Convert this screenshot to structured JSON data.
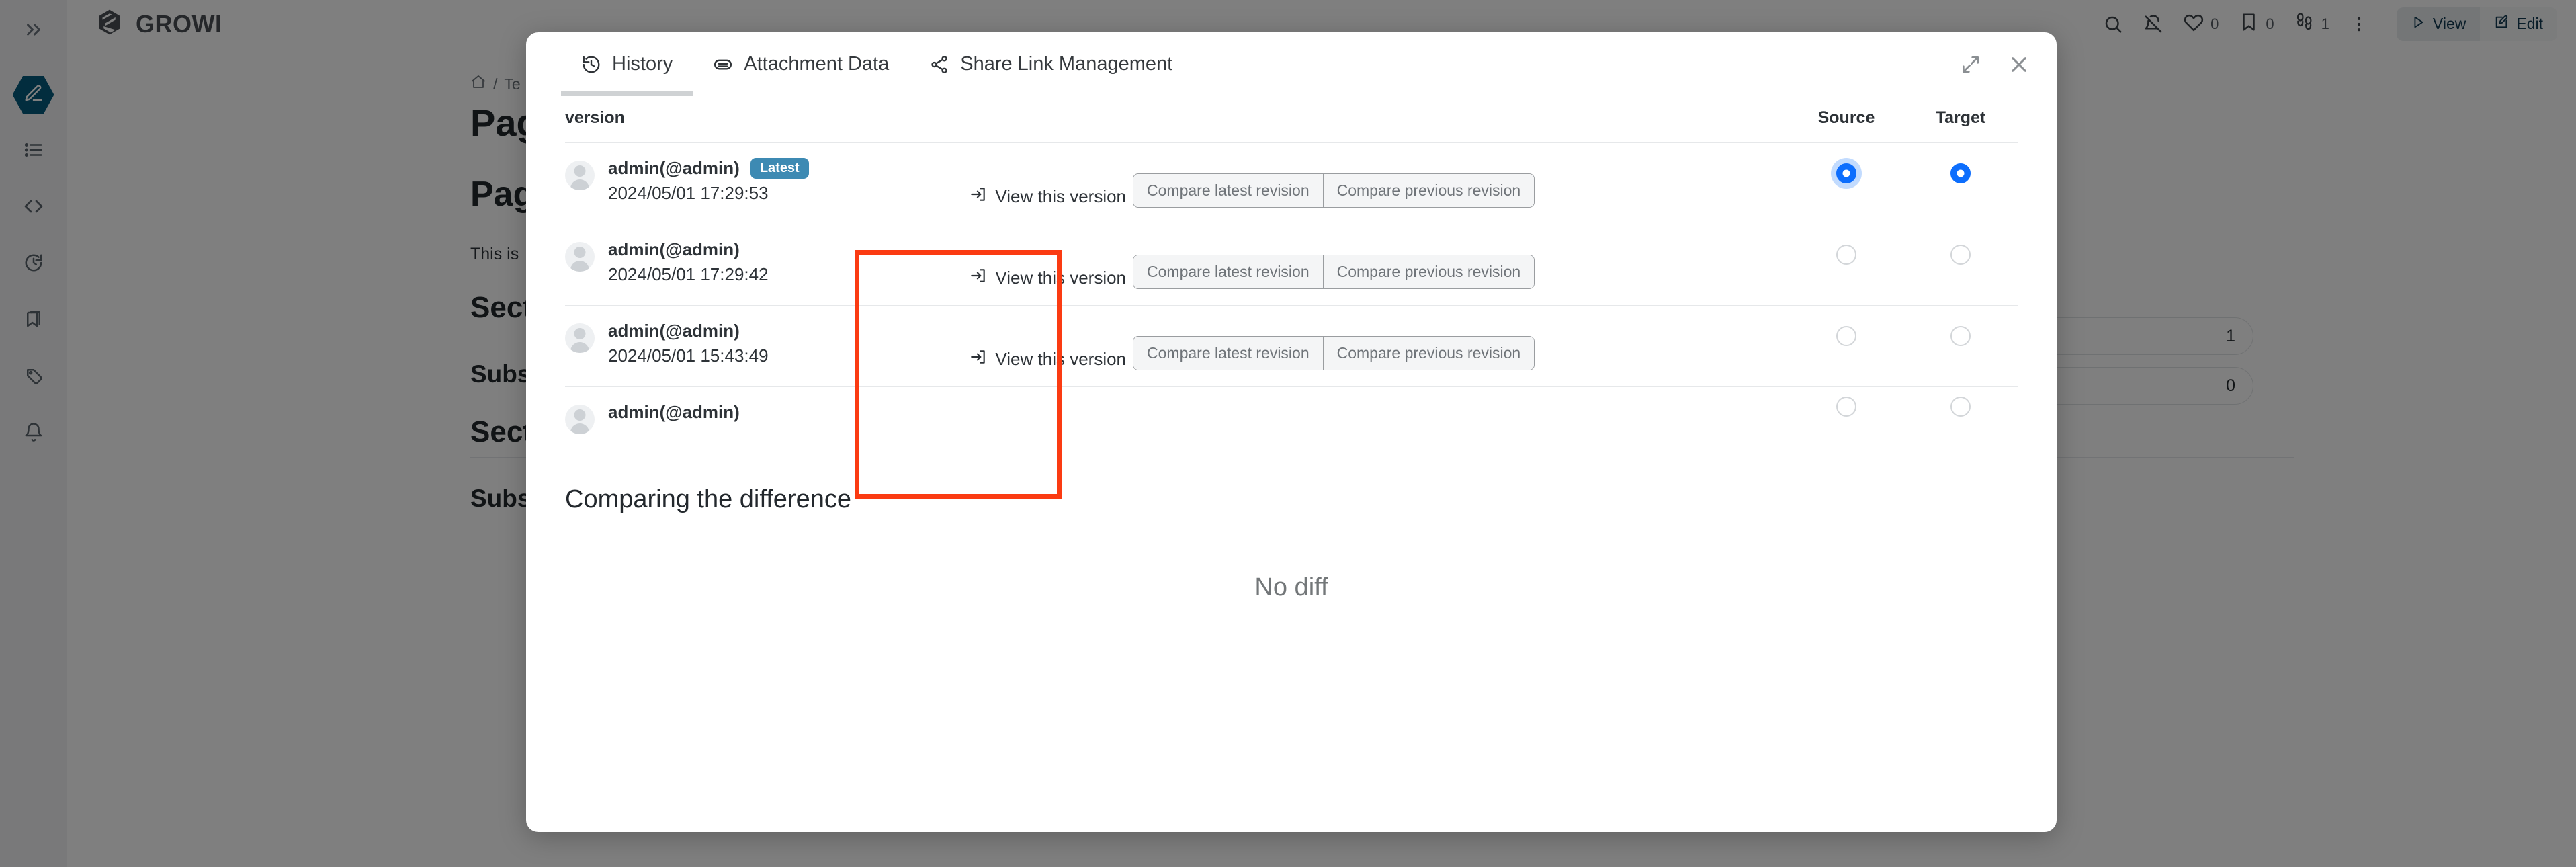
{
  "app": {
    "brand": "GROWI",
    "sidebar_icons": [
      {
        "name": "expand-sidebar-icon",
        "glyph": "»"
      },
      {
        "name": "edit-pencil-icon"
      },
      {
        "name": "page-tree-list-icon"
      },
      {
        "name": "code-brackets-icon"
      },
      {
        "name": "recent-changes-clock-icon"
      },
      {
        "name": "bookmarks-icon"
      },
      {
        "name": "tags-icon"
      },
      {
        "name": "notification-bell-icon"
      }
    ],
    "topbar": {
      "icons": [
        {
          "name": "search-icon"
        },
        {
          "name": "bell-off-icon"
        }
      ],
      "counters": [
        {
          "name": "like-heart-icon",
          "count": "0"
        },
        {
          "name": "bookmark-icon",
          "count": "0"
        },
        {
          "name": "footprints-seen-icon",
          "count": "1"
        }
      ],
      "more_menu": "more-vertical-icon",
      "view_label": "View",
      "edit_label": "Edit"
    },
    "page": {
      "breadcrumb_home": "⌂",
      "breadcrumb_sep": "/",
      "breadcrumb_item": "Te",
      "title": "Pag",
      "h1": "Pag",
      "paragraph": "This is",
      "section1": "Sect",
      "subsection1": "Subs",
      "section2": "Sect",
      "subsection2": "Subs",
      "side_counts": [
        "1",
        "0"
      ]
    }
  },
  "modal": {
    "tabs": [
      {
        "label": "History",
        "icon": "history-clock-icon",
        "active": true
      },
      {
        "label": "Attachment Data",
        "icon": "attachment-icon",
        "active": false
      },
      {
        "label": "Share Link Management",
        "icon": "share-nodes-icon",
        "active": false
      }
    ],
    "header_actions": [
      {
        "name": "expand-modal-icon"
      },
      {
        "name": "close-modal-icon"
      }
    ],
    "table": {
      "headers": {
        "version": "version",
        "source": "Source",
        "target": "Target"
      },
      "rows": [
        {
          "user": "admin(@admin)",
          "badge": "Latest",
          "date": "2024/05/01 17:29:53",
          "view_label": "View this version",
          "compare_latest": "Compare latest revision",
          "compare_previous": "Compare previous revision",
          "source_checked": true,
          "source_focused": true,
          "target_checked": true
        },
        {
          "user": "admin(@admin)",
          "badge": "",
          "date": "2024/05/01 17:29:42",
          "view_label": "View this version",
          "compare_latest": "Compare latest revision",
          "compare_previous": "Compare previous revision",
          "source_checked": false,
          "source_focused": false,
          "target_checked": false
        },
        {
          "user": "admin(@admin)",
          "badge": "",
          "date": "2024/05/01 15:43:49",
          "view_label": "View this version",
          "compare_latest": "Compare latest revision",
          "compare_previous": "Compare previous revision",
          "source_checked": false,
          "source_focused": false,
          "target_checked": false
        },
        {
          "user": "admin(@admin)",
          "badge": "",
          "date": "",
          "view_label": "",
          "compare_latest": "",
          "compare_previous": "",
          "source_checked": false,
          "source_focused": false,
          "target_checked": false
        }
      ]
    },
    "diff": {
      "title": "Comparing the difference",
      "empty_message": "No diff"
    },
    "annotation": {
      "color": "#fb3b12"
    }
  }
}
